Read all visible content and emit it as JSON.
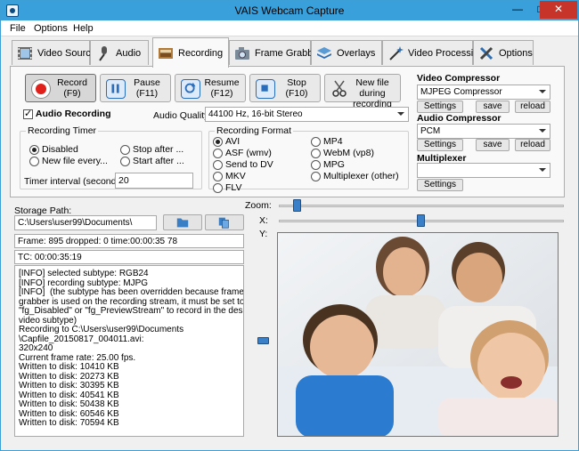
{
  "window": {
    "title": "VAIS Webcam Capture"
  },
  "menu": [
    "File",
    "Options",
    "Help"
  ],
  "tabs": [
    {
      "label": "Video Source",
      "icon": "film-icon",
      "active": false
    },
    {
      "label": "Audio",
      "icon": "microphone-icon",
      "active": false
    },
    {
      "label": "Recording",
      "icon": "recording-icon",
      "active": true
    },
    {
      "label": "Frame Grabber",
      "icon": "camera-icon",
      "active": false
    },
    {
      "label": "Overlays",
      "icon": "layers-icon",
      "active": false
    },
    {
      "label": "Video Processing",
      "icon": "magic-wand-icon",
      "active": false
    },
    {
      "label": "Options",
      "icon": "tools-icon",
      "active": false
    }
  ],
  "buttons": {
    "record": {
      "line1": "Record",
      "line2": "(F9)"
    },
    "pause": {
      "line1": "Pause",
      "line2": "(F11)"
    },
    "resume": {
      "line1": "Resume",
      "line2": "(F12)"
    },
    "stop": {
      "line1": "Stop",
      "line2": "(F10)"
    },
    "new_file": {
      "line1": "New file during",
      "line2": "recording"
    }
  },
  "audio_recording": {
    "label": "Audio Recording",
    "checked": true
  },
  "audio_quality": {
    "label": "Audio Quality:",
    "value": "44100 Hz, 16-bit Stereo"
  },
  "recording_timer": {
    "legend": "Recording Timer",
    "options": [
      "Disabled",
      "Stop after ...",
      "New file every...",
      "Start after ..."
    ],
    "selected": "Disabled",
    "interval_label": "Timer interval (seconds) :",
    "interval_value": "20"
  },
  "recording_format": {
    "legend": "Recording Format",
    "options": [
      "AVI",
      "MP4",
      "ASF (wmv)",
      "WebM (vp8)",
      "Send to DV",
      "MPG",
      "MKV",
      "Multiplexer (other)",
      "FLV"
    ],
    "selected": "AVI"
  },
  "video_compressor": {
    "label": "Video Compressor",
    "value": "MJPEG Compressor"
  },
  "audio_compressor": {
    "label": "Audio Compressor",
    "value": "PCM"
  },
  "multiplexer": {
    "label": "Multiplexer",
    "value": ""
  },
  "small_buttons": {
    "settings": "Settings",
    "save": "save",
    "reload": "reload"
  },
  "storage": {
    "label": "Storage Path:",
    "path": "C:\\Users\\user99\\Documents\\",
    "frame_info": "Frame: 895 dropped: 0 time:00:00:35 78",
    "tc": "TC: 00:00:35:19"
  },
  "log": [
    "[INFO] selected subtype: RGB24",
    "[INFO] recording subtype: MJPG",
    "[INFO]  (the subtype has been overridden because frame",
    "grabber is used on the recording stream, it must be set to",
    "\"fg_Disabled\" or \"fg_PreviewStream\" to record in the desired",
    "video subtype)",
    "Recording to C:\\Users\\user99\\Documents",
    "\\Capfile_20150817_004011.avi:",
    "320x240",
    "Current frame rate: 25.00 fps.",
    "Written to disk: 10410 KB",
    "Written to disk: 20273 KB",
    "Written to disk: 30395 KB",
    "Written to disk: 40541 KB",
    "Written to disk: 50438 KB",
    "Written to disk: 60546 KB",
    "Written to disk: 70594 KB"
  ],
  "controls": {
    "zoom_label": "Zoom:",
    "x_label": "X:",
    "y_label": "Y:",
    "zoom_level": 0.05,
    "x_level": 0.5
  },
  "colors": {
    "accent": "#3aa0dc",
    "close": "#c7342a",
    "record_dot": "#e0211b"
  }
}
